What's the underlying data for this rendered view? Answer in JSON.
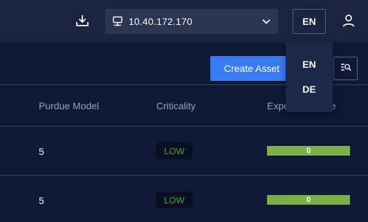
{
  "header": {
    "ip_address": "10.40.172.170",
    "language": "EN"
  },
  "toolbar": {
    "create_label": "Create Asset"
  },
  "table": {
    "columns": [
      "Purdue Model",
      "Criticality",
      "Exposure Score"
    ],
    "rows": [
      {
        "purdue": "5",
        "criticality": "LOW",
        "exposure": "0"
      },
      {
        "purdue": "5",
        "criticality": "LOW",
        "exposure": "0"
      }
    ]
  },
  "language_menu": {
    "options": [
      "EN",
      "DE"
    ]
  },
  "colors": {
    "background": "#0f1834",
    "topbar": "#1b2340",
    "accent": "#3b7bf2",
    "low": "#3fa33f",
    "score_bar": "#7cb14a"
  }
}
